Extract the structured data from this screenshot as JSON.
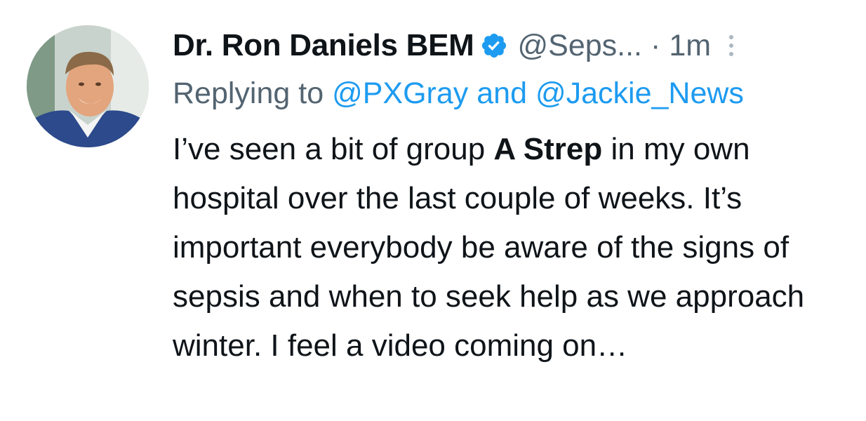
{
  "tweet": {
    "author": {
      "display_name": "Dr. Ron Daniels BEM",
      "handle": "@Seps...",
      "verified": true,
      "verified_icon": "verified-badge-icon"
    },
    "separator": "·",
    "time": "1m",
    "more_icon": "more-vertical-icon",
    "reply": {
      "prefix": "Replying to",
      "mention_1": "@PXGray",
      "conjunction": "and",
      "mention_2": "@Jackie_News"
    },
    "text": {
      "part1": "I’ve seen a bit of group ",
      "bold": "A Strep",
      "part2": " in my own hospital over the last couple of weeks. It’s important everybody be aware of the signs of sepsis and when to seek help as we approach winter. I feel a video coming on…"
    },
    "colors": {
      "link": "#1d9bf0",
      "secondary": "#536471",
      "verified": "#1d9bf0"
    }
  }
}
